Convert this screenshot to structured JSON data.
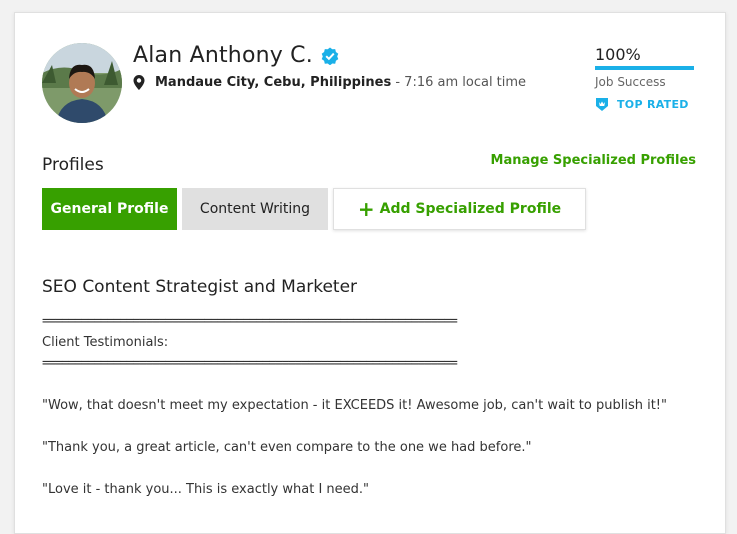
{
  "profile": {
    "name": "Alan Anthony C.",
    "location_city": "Mandaue City, Cebu, Philippines",
    "location_sep": " - ",
    "local_time": "7:16 am local time"
  },
  "stats": {
    "job_success_value": "100%",
    "job_success_fraction": 1.0,
    "job_success_label": "Job Success",
    "badge_label": "TOP RATED",
    "accent_color": "#1ab0e8"
  },
  "profiles_section": {
    "title": "Profiles",
    "manage_link": "Manage Specialized Profiles",
    "tabs": [
      {
        "label": "General Profile",
        "active": true
      },
      {
        "label": "Content Writing",
        "active": false
      }
    ],
    "add_label": "Add Specialized Profile"
  },
  "overview": {
    "headline": "SEO Content Strategist and Marketer",
    "rule": "================================================================",
    "testimonials_label": "Client Testimonials:",
    "quote1": "\"Wow, that doesn't meet my expectation - it EXCEEDS it! Awesome job, can't wait to publish it!\"",
    "quote2": "\"Thank you, a great article, can't even compare to the one we had before.\"",
    "quote3": "\"Love it - thank you... This is exactly what I need.\""
  },
  "colors": {
    "brand_green": "#37a000",
    "tab_inactive": "#e0e0e0"
  }
}
